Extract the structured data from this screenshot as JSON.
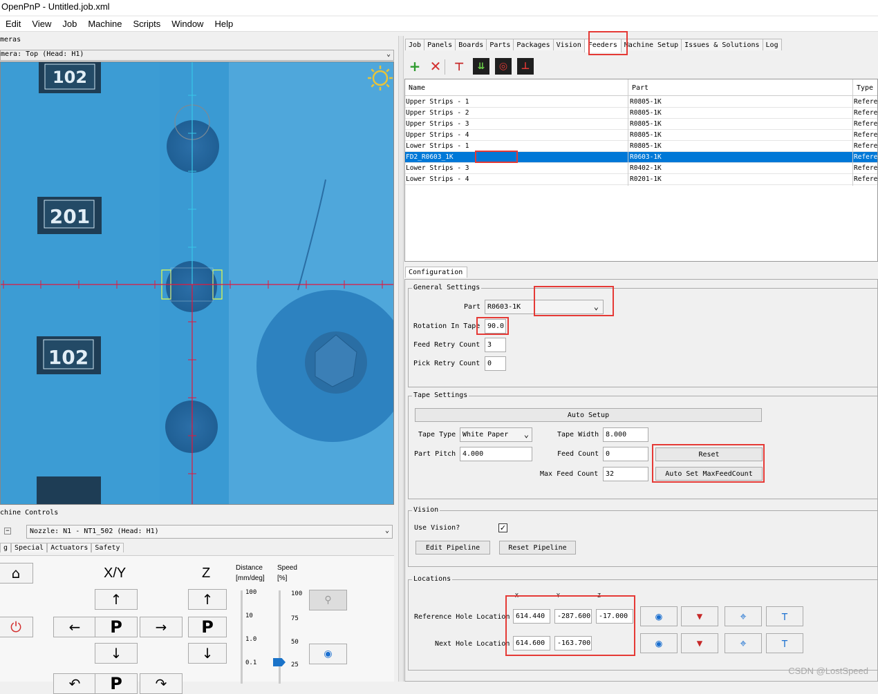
{
  "window": {
    "title": "OpenPnP - Untitled.job.xml"
  },
  "menu": [
    "Edit",
    "View",
    "Job",
    "Machine",
    "Scripts",
    "Window",
    "Help"
  ],
  "cameras": {
    "header": "meras",
    "select_value": "mera: Top (Head: H1)",
    "resistor_labels": [
      "102",
      "201",
      "102"
    ]
  },
  "machine_controls": {
    "header": "chine Controls",
    "nozzle_value": "Nozzle: N1 - NT1_502 (Head: H1)",
    "tabs": [
      "g",
      "Special",
      "Actuators",
      "Safety"
    ],
    "xy_label": "X/Y",
    "z_label": "Z",
    "p_label": "P",
    "distance_label": "Distance",
    "distance_unit": "[mm/deg]",
    "speed_label": "Speed",
    "speed_unit": "[%]",
    "distance_ticks": [
      "100",
      "10",
      "1.0",
      "0.1"
    ],
    "speed_ticks": [
      "100",
      "75",
      "50",
      "25"
    ]
  },
  "tabs": [
    "Job",
    "Panels",
    "Boards",
    "Parts",
    "Packages",
    "Vision",
    "Feeders",
    "Machine Setup",
    "Issues & Solutions",
    "Log"
  ],
  "active_tab": "Feeders",
  "feeders_table": {
    "columns": [
      "Name",
      "Part",
      "Type"
    ],
    "rows": [
      {
        "name": "Upper Strips - 1",
        "part": "R0805-1K",
        "type": "Refere",
        "selected": false
      },
      {
        "name": "Upper Strips - 2",
        "part": "R0805-1K",
        "type": "Refere",
        "selected": false
      },
      {
        "name": "Upper Strips - 3",
        "part": "R0805-1K",
        "type": "Refere",
        "selected": false
      },
      {
        "name": "Upper Strips - 4",
        "part": "R0805-1K",
        "type": "Refere",
        "selected": false
      },
      {
        "name": "Lower Strips - 1",
        "part": "R0805-1K",
        "type": "Refere",
        "selected": false
      },
      {
        "name": "FD2_R0603_1K",
        "part": "R0603-1K",
        "type": "Refere",
        "selected": true
      },
      {
        "name": "Lower Strips - 3",
        "part": "R0402-1K",
        "type": "Refere",
        "selected": false
      },
      {
        "name": "Lower Strips - 4",
        "part": "R0201-1K",
        "type": "Refere",
        "selected": false
      }
    ]
  },
  "config": {
    "tab_label": "Configuration",
    "general": {
      "title": "General Settings",
      "part_label": "Part",
      "part_value": "R0603-1K",
      "rotation_label": "Rotation In Tape",
      "rotation_value": "90.0",
      "feed_retry_label": "Feed Retry Count",
      "feed_retry_value": "3",
      "pick_retry_label": "Pick Retry Count",
      "pick_retry_value": "0"
    },
    "tape": {
      "title": "Tape Settings",
      "auto_setup": "Auto Setup",
      "tape_type_label": "Tape Type",
      "tape_type_value": "White Paper",
      "tape_width_label": "Tape Width",
      "tape_width_value": "8.000",
      "part_pitch_label": "Part Pitch",
      "part_pitch_value": "4.000",
      "feed_count_label": "Feed Count",
      "feed_count_value": "0",
      "max_feed_label": "Max Feed Count",
      "max_feed_value": "32",
      "reset": "Reset",
      "auto_set_max": "Auto Set MaxFeedCount"
    },
    "vision": {
      "title": "Vision",
      "use_vision_label": "Use Vision?",
      "use_vision_checked": true,
      "edit_pipeline": "Edit Pipeline",
      "reset_pipeline": "Reset Pipeline"
    },
    "locations": {
      "title": "Locations",
      "col_x": "X",
      "col_y": "Y",
      "col_z": "Z",
      "ref_label": "Reference Hole Location",
      "ref_x": "614.440",
      "ref_y": "-287.600",
      "ref_z": "-17.000",
      "next_label": "Next Hole Location",
      "next_x": "614.600",
      "next_y": "-163.700"
    }
  },
  "watermark": "CSDN @LostSpeed",
  "colors": {
    "selection": "#0078d7",
    "highlight": "#e53935",
    "camera_bg": "#3a9ad3"
  }
}
